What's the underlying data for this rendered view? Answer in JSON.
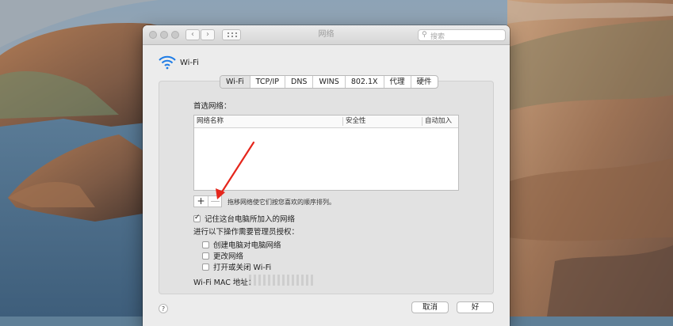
{
  "window": {
    "title": "网络",
    "nav_back": "‹",
    "nav_forward": "›",
    "search_placeholder": "搜索"
  },
  "interface": {
    "name": "Wi-Fi"
  },
  "tabs": [
    {
      "label": "Wi-Fi",
      "active": true
    },
    {
      "label": "TCP/IP",
      "active": false
    },
    {
      "label": "DNS",
      "active": false
    },
    {
      "label": "WINS",
      "active": false
    },
    {
      "label": "802.1X",
      "active": false
    },
    {
      "label": "代理",
      "active": false
    },
    {
      "label": "硬件",
      "active": false
    }
  ],
  "preferred_networks": {
    "label": "首选网络：",
    "columns": [
      "网络名称",
      "安全性",
      "自动加入"
    ],
    "rows": [],
    "add_label": "+",
    "remove_label": "—",
    "drag_hint": "拖移网络使它们按您喜欢的顺序排列。"
  },
  "options": {
    "remember_label": "记住这台电脑所加入的网络",
    "remember_checked": true,
    "admin_label": "进行以下操作需要管理员授权：",
    "admin_items": [
      {
        "label": "创建电脑对电脑网络",
        "checked": false
      },
      {
        "label": "更改网络",
        "checked": false
      },
      {
        "label": "打开或关闭 Wi-Fi",
        "checked": false
      }
    ]
  },
  "mac": {
    "label": "Wi-Fi MAC 地址：",
    "value": ""
  },
  "footer": {
    "help": "?",
    "cancel_label": "取消",
    "ok_label": "好"
  },
  "colors": {
    "annotation_arrow": "#e5261c"
  },
  "icons": {
    "wifi": "wifi-icon",
    "search": "search-icon"
  }
}
